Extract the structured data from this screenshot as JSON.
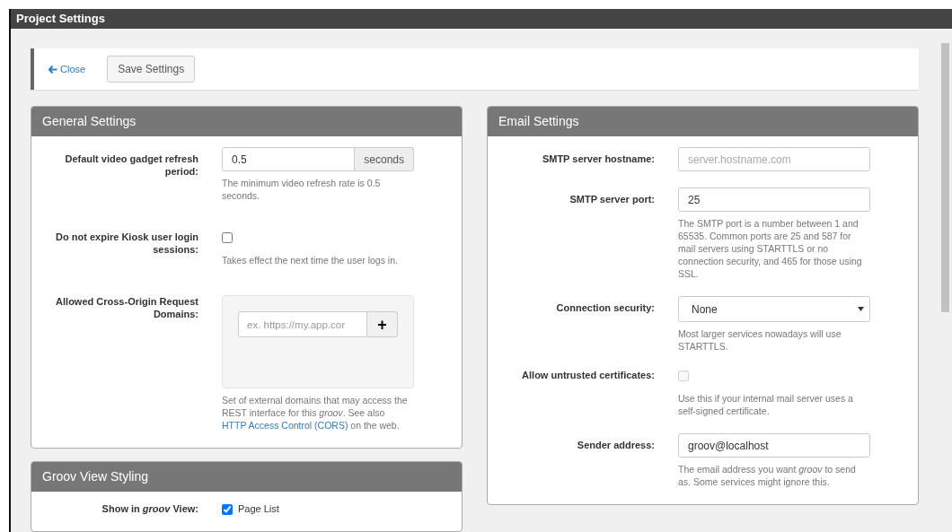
{
  "window": {
    "title": "Project Settings"
  },
  "toolbar": {
    "close_label": "Close",
    "save_label": "Save Settings"
  },
  "left_panels": [
    {
      "title": "General Settings",
      "rows": [
        {
          "kind": "addon",
          "label": "Default video gadget refresh period:",
          "value": "0.5",
          "addon": "seconds",
          "help": "The minimum video refresh rate is 0.5 seconds."
        },
        {
          "kind": "checkbox",
          "label": "Do not expire Kiosk user login sessions:",
          "checked": false,
          "help": "Takes effect the next time the user logs in."
        },
        {
          "kind": "list",
          "label": "Allowed Cross-Origin Request Domains:",
          "placeholder": "ex. https://my.app.cor",
          "add_label": "+",
          "help": "Set of external domains that may access the REST interface for this *groov*. See also ",
          "link": "HTTP Access Control (CORS)",
          "help_after": " on the web."
        }
      ]
    },
    {
      "title": "Groov View Styling",
      "rows": [
        {
          "kind": "checkbox",
          "label": "Show in *groov* View:",
          "checked": true,
          "option": "Page List"
        }
      ]
    }
  ],
  "right_panels": [
    {
      "title": "Email Settings",
      "rows": [
        {
          "kind": "text",
          "label": "SMTP server hostname:",
          "placeholder": "server.hostname.com"
        },
        {
          "kind": "text",
          "label": "SMTP server port:",
          "value": "25",
          "help": "The SMTP port is a number between 1 and 65535. Common ports are 25 and 587 for mail servers using STARTTLS or no connection security, and 465 for those using SSL."
        },
        {
          "kind": "select",
          "label": "Connection security:",
          "value": "None",
          "help": "Most larger services nowadays will use STARTTLS."
        },
        {
          "kind": "checkbox",
          "label": "Allow untrusted certificates:",
          "checked": false,
          "disabled": true,
          "help": "Use this if your internal mail server uses a self-signed certificate."
        },
        {
          "kind": "text",
          "label": "Sender address:",
          "value": "groov@localhost",
          "help": "The email address you want *groov* to send as. Some services might ignore this."
        }
      ]
    }
  ]
}
